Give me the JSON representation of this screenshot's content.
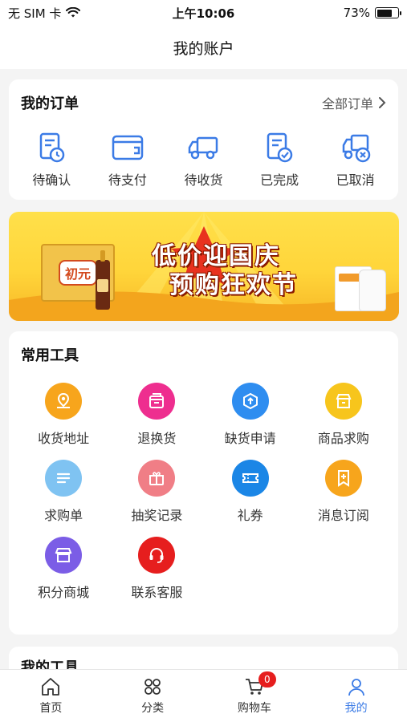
{
  "status_bar": {
    "carrier": "无 SIM 卡",
    "time": "上午10:06",
    "battery": "73%",
    "battery_level": 0.73
  },
  "nav": {
    "title": "我的账户"
  },
  "orders": {
    "title": "我的订单",
    "all_link": "全部订单",
    "items": [
      {
        "label": "待确认",
        "icon": "pending-confirm-icon"
      },
      {
        "label": "待支付",
        "icon": "wallet-icon"
      },
      {
        "label": "待收货",
        "icon": "truck-icon"
      },
      {
        "label": "已完成",
        "icon": "completed-doc-icon"
      },
      {
        "label": "已取消",
        "icon": "cancelled-truck-icon"
      }
    ],
    "accent": "#3b7be6"
  },
  "banner": {
    "line1": "低价迎国庆",
    "line2": "预购狂欢节",
    "product_logo": "初元"
  },
  "tools": {
    "title": "常用工具",
    "items": [
      {
        "label": "收货地址",
        "color": "#f7a51c",
        "icon": "location-icon"
      },
      {
        "label": "退换货",
        "color": "#ee2e8f",
        "icon": "return-box-icon"
      },
      {
        "label": "缺货申请",
        "color": "#2e8df0",
        "icon": "package-upload-icon"
      },
      {
        "label": "商品求购",
        "color": "#f7c51c",
        "icon": "shop-icon"
      },
      {
        "label": "求购单",
        "color": "#7fc3f2",
        "icon": "list-icon"
      },
      {
        "label": "抽奖记录",
        "color": "#f07e86",
        "icon": "gift-icon"
      },
      {
        "label": "礼券",
        "color": "#1b86e6",
        "icon": "ticket-icon"
      },
      {
        "label": "消息订阅",
        "color": "#f7a51c",
        "icon": "subscribe-icon"
      },
      {
        "label": "积分商城",
        "color": "#7b5de6",
        "icon": "store-icon"
      },
      {
        "label": "联系客服",
        "color": "#e61e1e",
        "icon": "headset-icon"
      }
    ]
  },
  "my_tools": {
    "title": "我的工具"
  },
  "tabbar": {
    "items": [
      {
        "label": "首页",
        "icon": "home-icon"
      },
      {
        "label": "分类",
        "icon": "grid-icon"
      },
      {
        "label": "购物车",
        "icon": "cart-icon",
        "badge": "0"
      },
      {
        "label": "我的",
        "icon": "user-icon",
        "active": true
      }
    ]
  }
}
